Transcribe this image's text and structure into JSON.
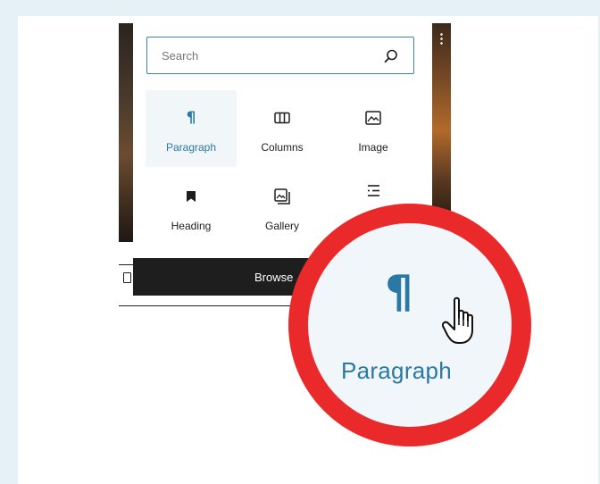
{
  "inserter": {
    "search_placeholder": "Search",
    "blocks": [
      {
        "label": "Paragraph",
        "icon": "paragraph-icon",
        "active": true
      },
      {
        "label": "Columns",
        "icon": "columns-icon",
        "active": false
      },
      {
        "label": "Image",
        "icon": "image-icon",
        "active": false
      },
      {
        "label": "Heading",
        "icon": "heading-icon",
        "active": false
      },
      {
        "label": "Gallery",
        "icon": "gallery-icon",
        "active": false
      },
      {
        "label": "",
        "icon": "list-icon",
        "active": false
      }
    ],
    "browse_all_label": "Browse"
  },
  "magnifier": {
    "icon_glyph": "¶",
    "label": "Paragraph"
  },
  "colors": {
    "accent": "#2a79a5",
    "highlight_ring": "#ea2a2a",
    "focus_border": "#3a88a8",
    "dark_bar": "#1e1e1e"
  }
}
